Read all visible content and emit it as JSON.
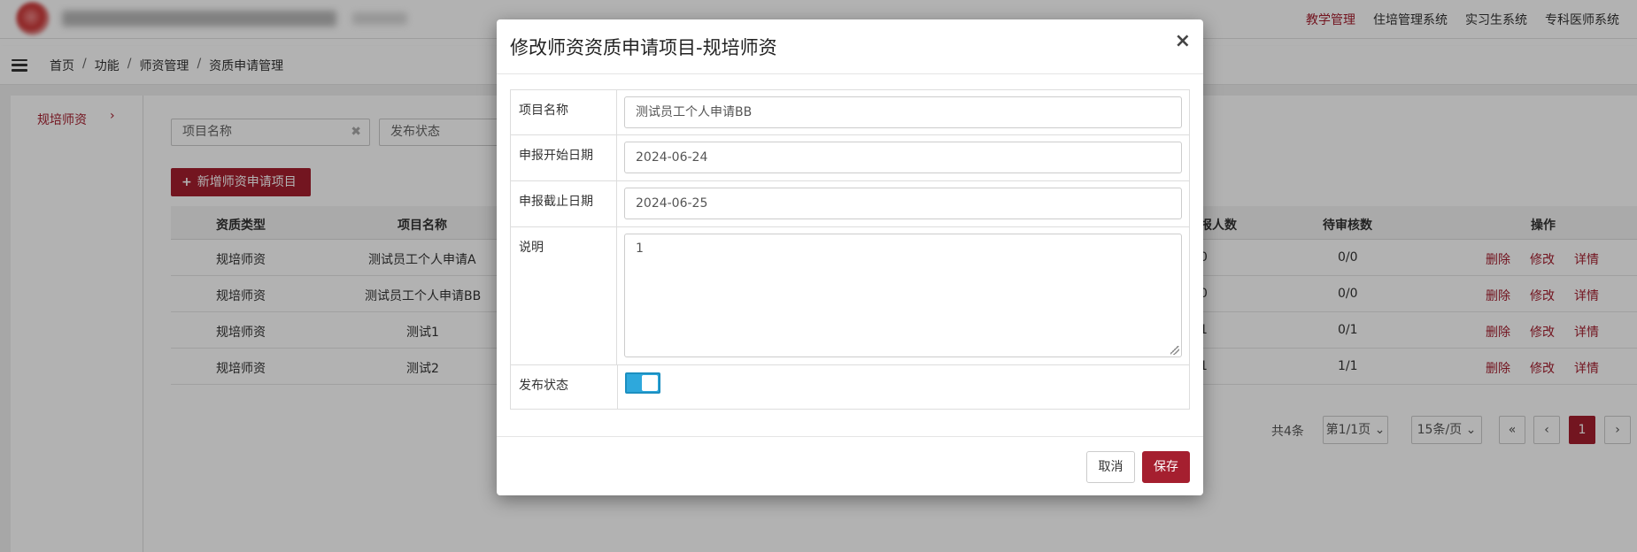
{
  "topnav": {
    "items": [
      "教学管理",
      "住培管理系统",
      "实习生系统",
      "专科医师系统"
    ]
  },
  "breadcrumb": [
    "首页",
    "功能",
    "师资管理",
    "资质申请管理"
  ],
  "sidebar": {
    "item_label": "规培师资",
    "arrow": "›"
  },
  "filters": {
    "project_name_placeholder": "项目名称",
    "publish_status_placeholder": "发布状态",
    "clear": "✖"
  },
  "add_button": {
    "plus": "+",
    "label": "新增师资申请项目"
  },
  "table": {
    "headers": [
      "资质类型",
      "项目名称",
      "报人数",
      "待审核数",
      "操作"
    ],
    "rows": [
      {
        "type": "规培师资",
        "name": "测试员工个人申请A",
        "count": "0",
        "pending": "0/0"
      },
      {
        "type": "规培师资",
        "name": "测试员工个人申请BB",
        "count": "0",
        "pending": "0/0"
      },
      {
        "type": "规培师资",
        "name": "测试1",
        "count": "1",
        "pending": "0/1"
      },
      {
        "type": "规培师资",
        "name": "测试2",
        "count": "1",
        "pending": "1/1"
      }
    ],
    "ops": [
      "删除",
      "修改",
      "详情"
    ]
  },
  "pager": {
    "total": "共4条",
    "page": "第1/1页",
    "page_size": "15条/页",
    "first": "«",
    "prev": "‹",
    "current": "1",
    "next": "›",
    "caret": "⌄"
  },
  "modal": {
    "title": "修改师资资质申请项目-规培师资",
    "close": "×",
    "fields": {
      "name_label": "项目名称",
      "name_value": "测试员工个人申请BB",
      "start_label": "申报开始日期",
      "start_value": "2024-06-24",
      "end_label": "申报截止日期",
      "end_value": "2024-06-25",
      "desc_label": "说明",
      "desc_value": "1",
      "publish_label": "发布状态"
    },
    "publish_on": true,
    "cancel_label": "取消",
    "save_label": "保存"
  },
  "colors": {
    "accent": "#a51f2f",
    "toggle": "#2ea8dc"
  }
}
